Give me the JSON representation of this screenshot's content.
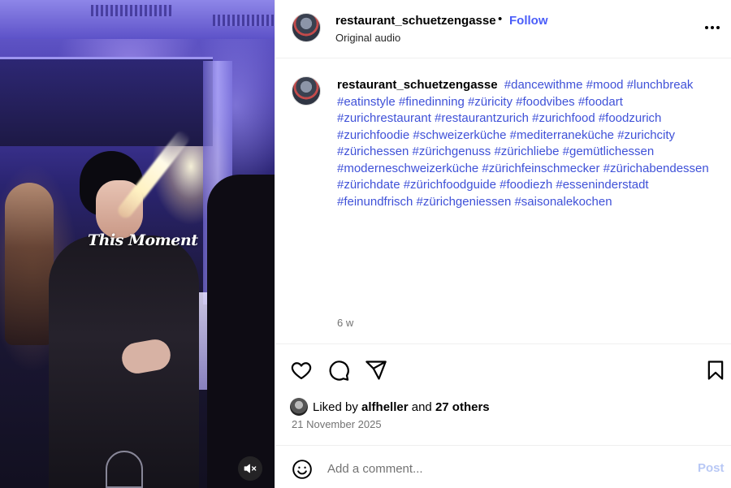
{
  "media": {
    "overlay_text": "This Moment",
    "mute_icon": "speaker-muted-icon"
  },
  "header": {
    "username": "restaurant_schuetzengasse",
    "separator": "•",
    "follow_label": "Follow",
    "subtitle": "Original audio",
    "more_icon": "more-horizontal-icon"
  },
  "caption": {
    "username": "restaurant_schuetzengasse",
    "hashtags": "#dancewithme #mood #lunchbreak #eatinstyle #finedinning #züricity #foodvibes #foodart #zurichrestaurant #restaurantzurich #zurichfood #foodzurich #zurichfoodie #schweizerküche #mediterraneküche #zurichcity #zürichessen #zürichgenuss #zürichliebe #gemütlichessen #moderneschweizerküche #zürichfeinschmecker #zürichabendessen #zürichdate #zürichfoodguide #foodiezh #esseninderstadt #feinundfrisch #zürichgeniessen #saisonalekochen",
    "age": "6 w"
  },
  "actions": {
    "like_icon": "heart-icon",
    "comment_icon": "comment-icon",
    "share_icon": "share-icon",
    "save_icon": "bookmark-icon"
  },
  "likes": {
    "prefix": "Liked by",
    "user": "alfheller",
    "conjunction": "and",
    "others": "27 others"
  },
  "date": "21 November 2025",
  "comment": {
    "placeholder": "Add a comment...",
    "post_label": "Post",
    "emoji_icon": "emoji-icon"
  },
  "colors": {
    "link_blue": "#4a5df9",
    "hashtag_blue": "#3f51d8",
    "post_disabled": "#b8c8f5",
    "muted_text": "#737373"
  }
}
